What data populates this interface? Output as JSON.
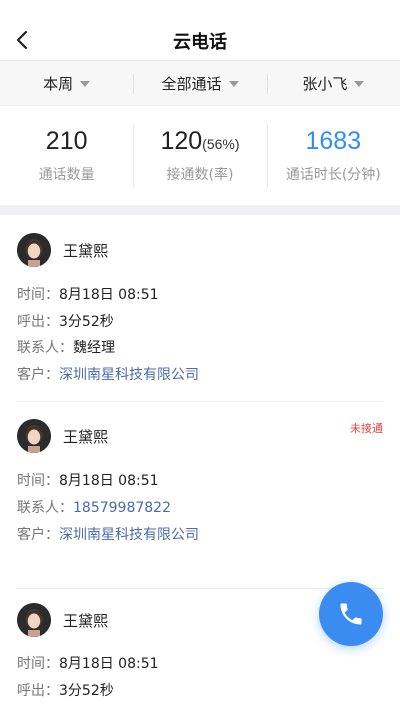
{
  "nav": {
    "title": "云电话",
    "back_icon": "chevron-left-icon"
  },
  "filters": [
    {
      "label": "本周"
    },
    {
      "label": "全部通话"
    },
    {
      "label": "张小飞"
    }
  ],
  "stats": {
    "call_count": {
      "value": "210",
      "label": "通话数量"
    },
    "answered": {
      "value": "120",
      "pct": "(56%)",
      "label": "接通数(率)"
    },
    "duration": {
      "value": "1683",
      "label": "通话时长(分钟)"
    }
  },
  "accent_color": "#2f8ef7",
  "calls": [
    {
      "name": "王黛熙",
      "badge": "",
      "time_label": "时间：",
      "time": "8月18日 08:51",
      "outgoing_label": "呼出：",
      "outgoing": "3分52秒",
      "contact_label": "联系人：",
      "contact": "魏经理",
      "customer_label": "客户：",
      "customer": "深圳南星科技有限公司"
    },
    {
      "name": "王黛熙",
      "badge": "未接通",
      "time_label": "时间：",
      "time": "8月18日 08:51",
      "contact_label": "联系人：",
      "contact": "18579987822",
      "customer_label": "客户：",
      "customer": "深圳南星科技有限公司"
    },
    {
      "name": "王黛熙",
      "badge": "",
      "time_label": "时间：",
      "time": "8月18日 08:51",
      "outgoing_label": "呼出：",
      "outgoing": "3分52秒"
    }
  ],
  "fab": {
    "icon": "phone-icon"
  }
}
